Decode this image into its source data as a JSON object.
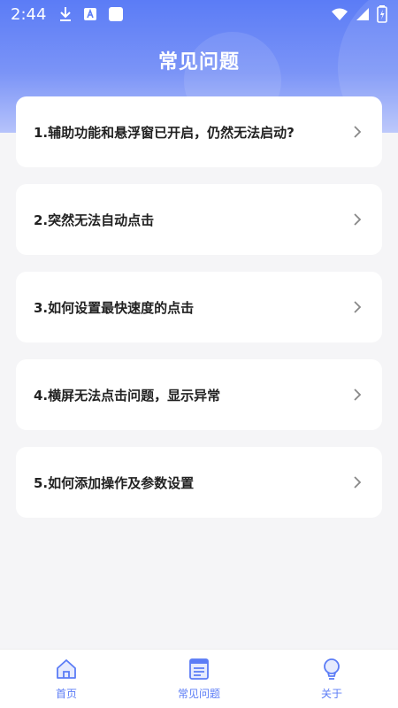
{
  "status_bar": {
    "time": "2:44",
    "left_icons": [
      "download-icon",
      "app-store-icon",
      "square-icon"
    ],
    "right_icons": [
      "wifi-icon",
      "signal-icon",
      "battery-charging-icon"
    ]
  },
  "header": {
    "title": "常见问题",
    "gradient_top": "#5b7cf6",
    "gradient_bottom": "#b6c3fb"
  },
  "faq_items": [
    {
      "label": "1.辅助功能和悬浮窗已开启，仍然无法启动?"
    },
    {
      "label": "2.突然无法自动点击"
    },
    {
      "label": "3.如何设置最快速度的点击"
    },
    {
      "label": "4.横屏无法点击问题，显示异常"
    },
    {
      "label": "5.如何添加操作及参数设置"
    }
  ],
  "bottom_nav": {
    "items": [
      {
        "label": "首页",
        "icon": "home-icon"
      },
      {
        "label": "常见问题",
        "icon": "faq-doc-icon"
      },
      {
        "label": "关于",
        "icon": "lightbulb-icon"
      }
    ],
    "accent": "#5b7cf6"
  }
}
